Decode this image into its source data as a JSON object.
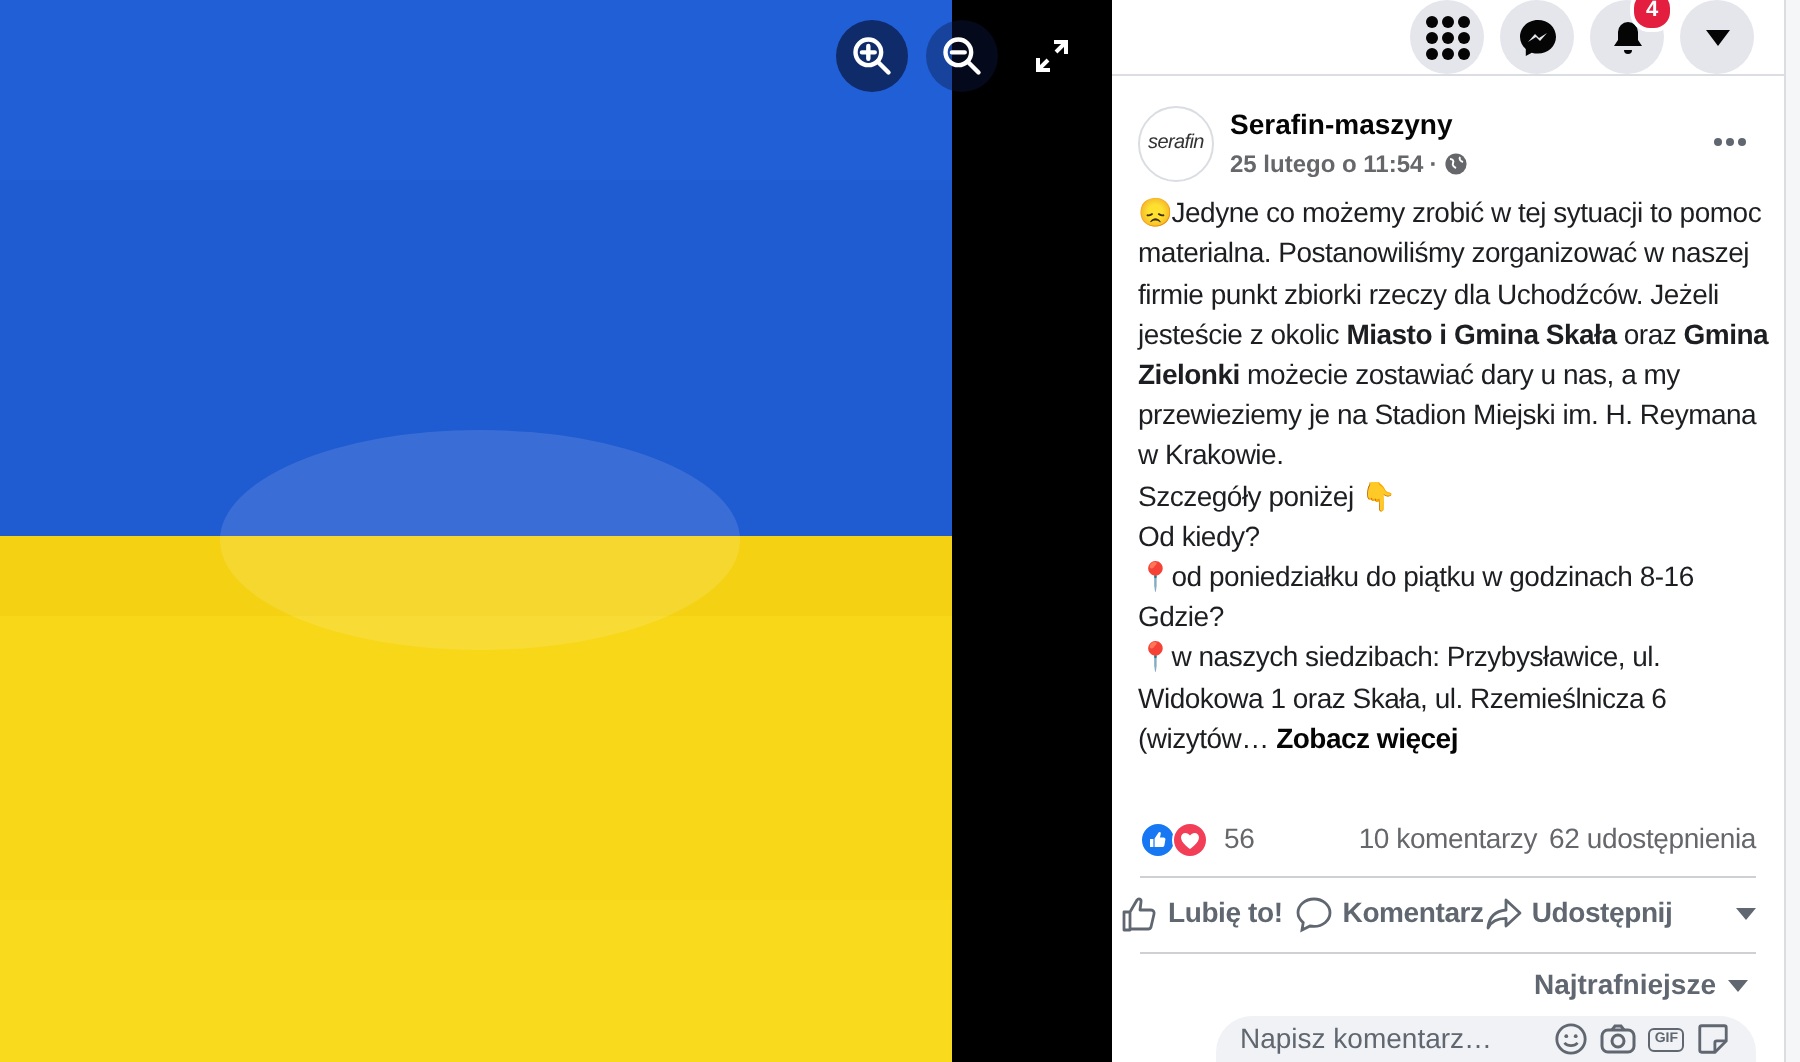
{
  "viewer": {
    "controls": [
      {
        "kind": "zoom-in"
      },
      {
        "kind": "zoom-out"
      },
      {
        "kind": "expand"
      }
    ]
  },
  "top_bar": {
    "buttons": [
      {
        "kind": "apps"
      },
      {
        "kind": "messenger"
      },
      {
        "kind": "notifications",
        "badge": "4"
      },
      {
        "kind": "account-menu"
      }
    ]
  },
  "post": {
    "author": "Serafin-maszyny",
    "logo_text": "serafin",
    "date": "25 lutego o 11:54",
    "date_separator": "·",
    "lines": [
      "😞Jedyne co możemy zrobić w tej sytuacji to pomoc materialna. Postanowiliśmy zorganizować w naszej firmie punkt zbiorki rzeczy dla Uchodźców. Jeżeli jesteście z okolic **Miasto i Gmina Skała** oraz **Gmina Zielonki** możecie zostawiać dary u nas, a my przewieziemy je na Stadion Miejski im. H. Reymana w Krakowie.",
      "Szczegóły poniżej 👇",
      "Od kiedy?",
      "📍od poniedziałku do piątku w godzinach 8-16",
      "Gdzie?",
      "📍w naszych siedzibach: Przybysławice, ul. Widokowa 1 oraz Skała, ul. Rzemieślnicza 6 (wizytów…"
    ],
    "see_more": "Zobacz więcej"
  },
  "stats": {
    "reaction_count": "56",
    "comments": "10 komentarzy",
    "shares": "62 udostępnienia"
  },
  "actions": [
    {
      "kind": "like",
      "label": "Lubię to!"
    },
    {
      "kind": "comment",
      "label": "Komentarz"
    },
    {
      "kind": "share",
      "label": "Udostępnij"
    }
  ],
  "sort": "Najtrafniejsze",
  "comment_box": {
    "placeholder": "Napisz komentarz…",
    "tools": [
      {
        "kind": "emoji"
      },
      {
        "kind": "camera"
      },
      {
        "kind": "gif",
        "label": "GIF"
      },
      {
        "kind": "sticker"
      }
    ]
  }
}
